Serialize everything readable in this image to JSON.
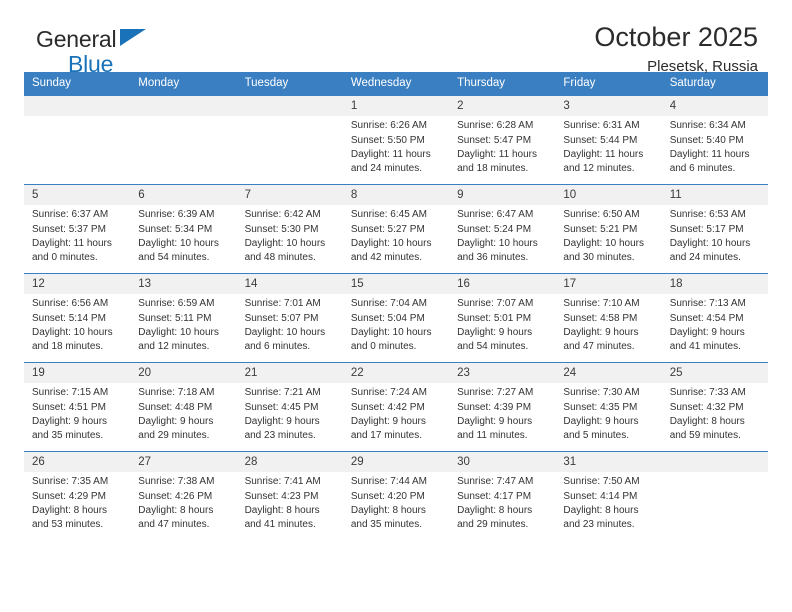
{
  "brand": {
    "line1": "General",
    "line2": "Blue",
    "triangle_color": "#1a72b8"
  },
  "header": {
    "title": "October 2025",
    "subtitle": "Plesetsk, Russia"
  },
  "theme": {
    "header_blue": "#3a7fc1",
    "daynum_bg": "#f1f1f1",
    "text": "#333333"
  },
  "calendar": {
    "weekday_headers": [
      "Sunday",
      "Monday",
      "Tuesday",
      "Wednesday",
      "Thursday",
      "Friday",
      "Saturday"
    ],
    "weeks": [
      [
        {
          "day": "",
          "empty": true
        },
        {
          "day": "",
          "empty": true
        },
        {
          "day": "",
          "empty": true
        },
        {
          "day": "1",
          "sunrise": "Sunrise: 6:26 AM",
          "sunset": "Sunset: 5:50 PM",
          "daylight": "Daylight: 11 hours and 24 minutes."
        },
        {
          "day": "2",
          "sunrise": "Sunrise: 6:28 AM",
          "sunset": "Sunset: 5:47 PM",
          "daylight": "Daylight: 11 hours and 18 minutes."
        },
        {
          "day": "3",
          "sunrise": "Sunrise: 6:31 AM",
          "sunset": "Sunset: 5:44 PM",
          "daylight": "Daylight: 11 hours and 12 minutes."
        },
        {
          "day": "4",
          "sunrise": "Sunrise: 6:34 AM",
          "sunset": "Sunset: 5:40 PM",
          "daylight": "Daylight: 11 hours and 6 minutes."
        }
      ],
      [
        {
          "day": "5",
          "sunrise": "Sunrise: 6:37 AM",
          "sunset": "Sunset: 5:37 PM",
          "daylight": "Daylight: 11 hours and 0 minutes."
        },
        {
          "day": "6",
          "sunrise": "Sunrise: 6:39 AM",
          "sunset": "Sunset: 5:34 PM",
          "daylight": "Daylight: 10 hours and 54 minutes."
        },
        {
          "day": "7",
          "sunrise": "Sunrise: 6:42 AM",
          "sunset": "Sunset: 5:30 PM",
          "daylight": "Daylight: 10 hours and 48 minutes."
        },
        {
          "day": "8",
          "sunrise": "Sunrise: 6:45 AM",
          "sunset": "Sunset: 5:27 PM",
          "daylight": "Daylight: 10 hours and 42 minutes."
        },
        {
          "day": "9",
          "sunrise": "Sunrise: 6:47 AM",
          "sunset": "Sunset: 5:24 PM",
          "daylight": "Daylight: 10 hours and 36 minutes."
        },
        {
          "day": "10",
          "sunrise": "Sunrise: 6:50 AM",
          "sunset": "Sunset: 5:21 PM",
          "daylight": "Daylight: 10 hours and 30 minutes."
        },
        {
          "day": "11",
          "sunrise": "Sunrise: 6:53 AM",
          "sunset": "Sunset: 5:17 PM",
          "daylight": "Daylight: 10 hours and 24 minutes."
        }
      ],
      [
        {
          "day": "12",
          "sunrise": "Sunrise: 6:56 AM",
          "sunset": "Sunset: 5:14 PM",
          "daylight": "Daylight: 10 hours and 18 minutes."
        },
        {
          "day": "13",
          "sunrise": "Sunrise: 6:59 AM",
          "sunset": "Sunset: 5:11 PM",
          "daylight": "Daylight: 10 hours and 12 minutes."
        },
        {
          "day": "14",
          "sunrise": "Sunrise: 7:01 AM",
          "sunset": "Sunset: 5:07 PM",
          "daylight": "Daylight: 10 hours and 6 minutes."
        },
        {
          "day": "15",
          "sunrise": "Sunrise: 7:04 AM",
          "sunset": "Sunset: 5:04 PM",
          "daylight": "Daylight: 10 hours and 0 minutes."
        },
        {
          "day": "16",
          "sunrise": "Sunrise: 7:07 AM",
          "sunset": "Sunset: 5:01 PM",
          "daylight": "Daylight: 9 hours and 54 minutes."
        },
        {
          "day": "17",
          "sunrise": "Sunrise: 7:10 AM",
          "sunset": "Sunset: 4:58 PM",
          "daylight": "Daylight: 9 hours and 47 minutes."
        },
        {
          "day": "18",
          "sunrise": "Sunrise: 7:13 AM",
          "sunset": "Sunset: 4:54 PM",
          "daylight": "Daylight: 9 hours and 41 minutes."
        }
      ],
      [
        {
          "day": "19",
          "sunrise": "Sunrise: 7:15 AM",
          "sunset": "Sunset: 4:51 PM",
          "daylight": "Daylight: 9 hours and 35 minutes."
        },
        {
          "day": "20",
          "sunrise": "Sunrise: 7:18 AM",
          "sunset": "Sunset: 4:48 PM",
          "daylight": "Daylight: 9 hours and 29 minutes."
        },
        {
          "day": "21",
          "sunrise": "Sunrise: 7:21 AM",
          "sunset": "Sunset: 4:45 PM",
          "daylight": "Daylight: 9 hours and 23 minutes."
        },
        {
          "day": "22",
          "sunrise": "Sunrise: 7:24 AM",
          "sunset": "Sunset: 4:42 PM",
          "daylight": "Daylight: 9 hours and 17 minutes."
        },
        {
          "day": "23",
          "sunrise": "Sunrise: 7:27 AM",
          "sunset": "Sunset: 4:39 PM",
          "daylight": "Daylight: 9 hours and 11 minutes."
        },
        {
          "day": "24",
          "sunrise": "Sunrise: 7:30 AM",
          "sunset": "Sunset: 4:35 PM",
          "daylight": "Daylight: 9 hours and 5 minutes."
        },
        {
          "day": "25",
          "sunrise": "Sunrise: 7:33 AM",
          "sunset": "Sunset: 4:32 PM",
          "daylight": "Daylight: 8 hours and 59 minutes."
        }
      ],
      [
        {
          "day": "26",
          "sunrise": "Sunrise: 7:35 AM",
          "sunset": "Sunset: 4:29 PM",
          "daylight": "Daylight: 8 hours and 53 minutes."
        },
        {
          "day": "27",
          "sunrise": "Sunrise: 7:38 AM",
          "sunset": "Sunset: 4:26 PM",
          "daylight": "Daylight: 8 hours and 47 minutes."
        },
        {
          "day": "28",
          "sunrise": "Sunrise: 7:41 AM",
          "sunset": "Sunset: 4:23 PM",
          "daylight": "Daylight: 8 hours and 41 minutes."
        },
        {
          "day": "29",
          "sunrise": "Sunrise: 7:44 AM",
          "sunset": "Sunset: 4:20 PM",
          "daylight": "Daylight: 8 hours and 35 minutes."
        },
        {
          "day": "30",
          "sunrise": "Sunrise: 7:47 AM",
          "sunset": "Sunset: 4:17 PM",
          "daylight": "Daylight: 8 hours and 29 minutes."
        },
        {
          "day": "31",
          "sunrise": "Sunrise: 7:50 AM",
          "sunset": "Sunset: 4:14 PM",
          "daylight": "Daylight: 8 hours and 23 minutes."
        },
        {
          "day": "",
          "empty": true
        }
      ]
    ]
  }
}
